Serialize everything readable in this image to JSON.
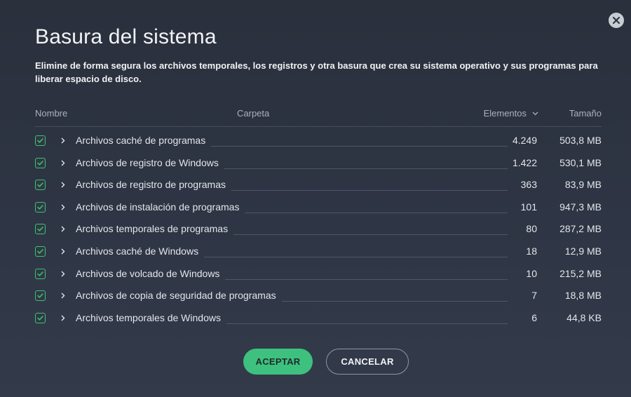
{
  "dialog": {
    "title": "Basura del sistema",
    "description": "Elimine de forma segura los archivos temporales, los registros y otra basura que crea su sistema operativo y sus programas para liberar espacio de disco."
  },
  "table": {
    "headers": {
      "name": "Nombre",
      "folder": "Carpeta",
      "items": "Elementos",
      "size": "Tamaño"
    },
    "rows": [
      {
        "name": "Archivos caché de programas",
        "count": "4.249",
        "size": "503,8 MB",
        "checked": true
      },
      {
        "name": "Archivos de registro de Windows",
        "count": "1.422",
        "size": "530,1 MB",
        "checked": true
      },
      {
        "name": "Archivos de registro de programas",
        "count": "363",
        "size": "83,9 MB",
        "checked": true
      },
      {
        "name": "Archivos de instalación de programas",
        "count": "101",
        "size": "947,3 MB",
        "checked": true
      },
      {
        "name": "Archivos temporales de programas",
        "count": "80",
        "size": "287,2 MB",
        "checked": true
      },
      {
        "name": "Archivos caché de Windows",
        "count": "18",
        "size": "12,9 MB",
        "checked": true
      },
      {
        "name": "Archivos de volcado de Windows",
        "count": "10",
        "size": "215,2 MB",
        "checked": true
      },
      {
        "name": "Archivos de copia de seguridad de programas",
        "count": "7",
        "size": "18,8 MB",
        "checked": true
      },
      {
        "name": "Archivos temporales de Windows",
        "count": "6",
        "size": "44,8 KB",
        "checked": true
      }
    ]
  },
  "buttons": {
    "accept": "ACEPTAR",
    "cancel": "CANCELAR"
  },
  "icons": {
    "close": "close-icon",
    "check": "check-icon",
    "expand": "chevron-right-icon",
    "sort": "chevron-down-icon"
  },
  "colors": {
    "accent": "#3ec17f",
    "background": "#2e3544"
  }
}
